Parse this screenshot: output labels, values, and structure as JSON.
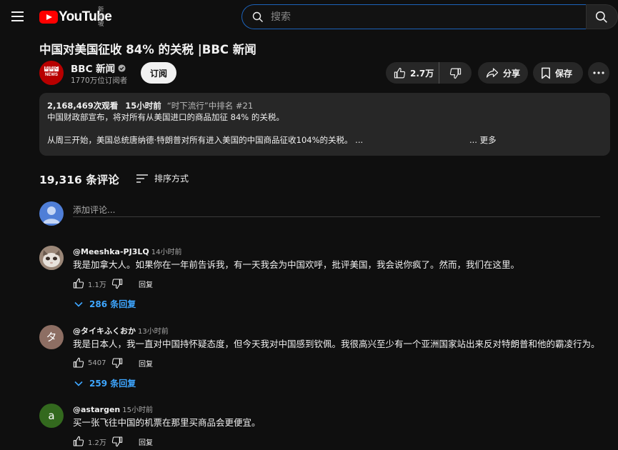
{
  "header": {
    "logo_text": "YouTube",
    "region": "新加坡",
    "search_placeholder": "搜索"
  },
  "video": {
    "title": "中国对美国征收 84% 的关税 |BBC 新闻"
  },
  "channel": {
    "avatar_top": "BBC",
    "avatar_bottom": "NEWS",
    "name": "BBC 新闻",
    "subscribers": "1770万位订阅者",
    "subscribe_label": "订阅"
  },
  "actions": {
    "like_count": "2.7万",
    "share_label": "分享",
    "save_label": "保存"
  },
  "description": {
    "views": "2,168,469次观看",
    "time": "15小时前",
    "trending": "“时下流行”中排名 #21",
    "line1": "中国财政部宣布，将对所有从美国进口的商品加征 84% 的关税。",
    "line2": "从周三开始，美国总统唐纳德·特朗普对所有进入美国的中国商品征收104%的关税。 ...",
    "more_label": "... 更多"
  },
  "comments": {
    "count_label": "19,316 条评论",
    "sort_label": "排序方式",
    "add_placeholder": "添加评论...",
    "reply_label": "回复",
    "items": [
      {
        "author": "@Meeshka-PJ3LQ",
        "time": "14小时前",
        "text": "我是加拿大人。如果你在一年前告诉我，有一天我会为中国欢呼，批评美国，我会说你疯了。然而，我们在这里。",
        "likes": "1.1万",
        "replies": "286 条回复",
        "avatar_color": "#7a6a5a",
        "avatar_letter": ""
      },
      {
        "author": "@タイキふくおか",
        "time": "13小时前",
        "text": "我是日本人，我一直对中国持怀疑态度，但今天我对中国感到钦佩。我很高兴至少有一个亚洲国家站出来反对特朗普和他的霸凌行为。",
        "likes": "5407",
        "replies": "259 条回复",
        "avatar_color": "#8d6e63",
        "avatar_letter": "タ"
      },
      {
        "author": "@astargen",
        "time": "15小时前",
        "text": "买一张飞往中国的机票在那里买商品会更便宜。",
        "likes": "1.2万",
        "replies": "",
        "avatar_color": "#33691e",
        "avatar_letter": "a"
      }
    ]
  }
}
